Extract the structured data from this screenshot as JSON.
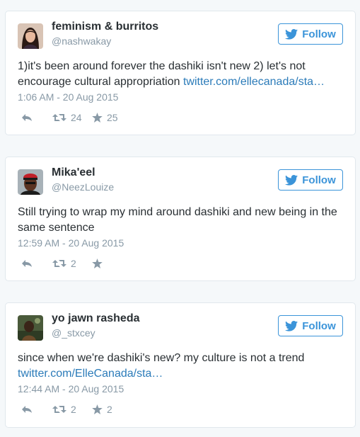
{
  "tweets": [
    {
      "name": "feminism & burritos",
      "handle": "@nashwakay",
      "text": "1)it's been around forever the dashiki isn't new 2) let's not encourage cultural appropriation ",
      "link": "twitter.com/ellecanada/sta…",
      "time": "1:06 AM - 20 Aug 2015",
      "retweets": "24",
      "likes": "25",
      "follow_label": "Follow"
    },
    {
      "name": "Mika'eel",
      "handle": "@NeezLouize",
      "text": "Still trying to wrap my mind around dashiki and new being in the same sentence",
      "time": "12:59 AM - 20 Aug 2015",
      "retweets": "2",
      "likes": "",
      "follow_label": "Follow"
    },
    {
      "name": "yo jawn rasheda",
      "handle": "@_stxcey",
      "text": "since when we're dashiki's new? my culture is not a trend",
      "link": "twitter.com/ElleCanada/sta…",
      "time": "12:44 AM - 20 Aug 2015",
      "retweets": "2",
      "likes": "2",
      "follow_label": "Follow"
    }
  ],
  "colors": {
    "accent": "#3b94d9",
    "link": "#2b7bb9",
    "muted": "#8899a6",
    "text": "#292f33",
    "background": "#f5f8fa"
  },
  "icons": [
    "twitter-bird-icon",
    "reply-icon",
    "retweet-icon",
    "star-icon"
  ]
}
